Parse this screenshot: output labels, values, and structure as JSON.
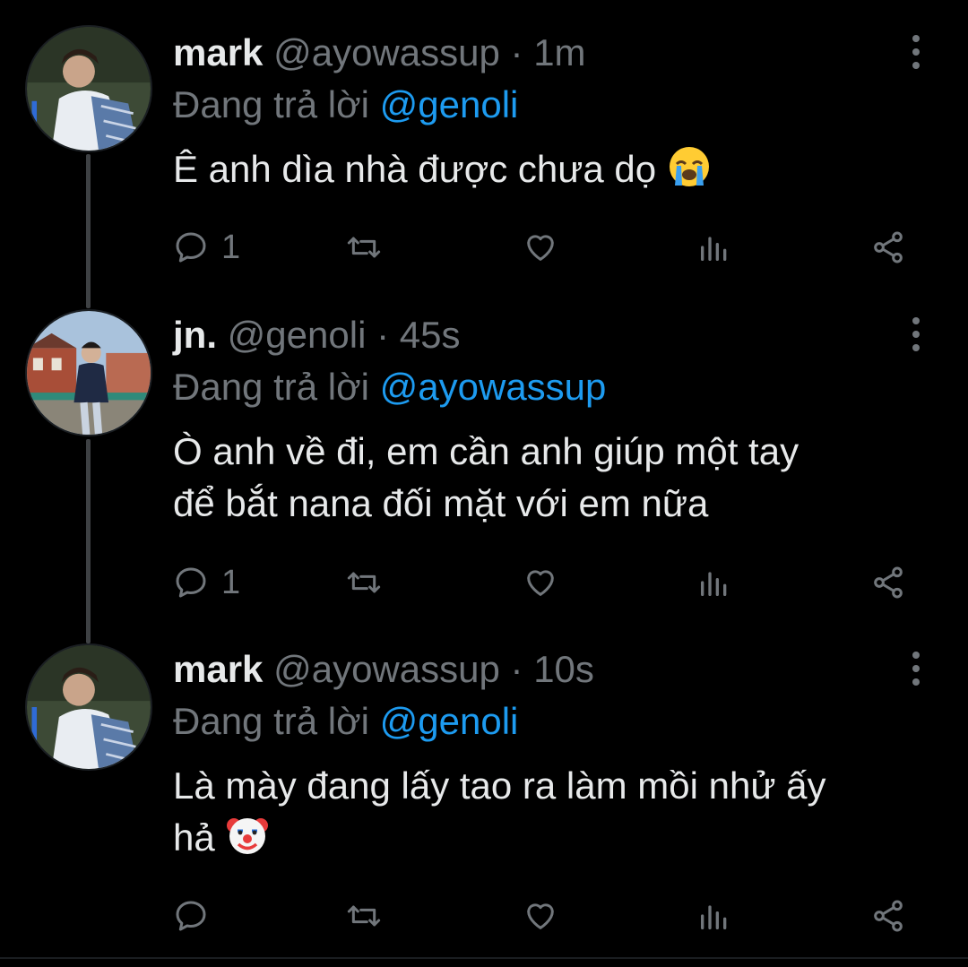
{
  "tweets": [
    {
      "name": "mark",
      "handle": "@ayowassup",
      "dot": "·",
      "time": "1m",
      "reply_prefix": "Đang trả lời",
      "reply_to": "@genoli",
      "text": "Ê anh dìa nhà được chưa dọ",
      "emoji": "loudly-crying-face",
      "reply_count": "1"
    },
    {
      "name": "jn.",
      "handle": "@genoli",
      "dot": "·",
      "time": "45s",
      "reply_prefix": "Đang trả lời",
      "reply_to": "@ayowassup",
      "text_line1": "Ò anh về đi, em cần anh giúp một tay",
      "text_line2": "để bắt nana đối mặt với em nữa",
      "reply_count": "1"
    },
    {
      "name": "mark",
      "handle": "@ayowassup",
      "dot": "·",
      "time": "10s",
      "reply_prefix": "Đang trả lời",
      "reply_to": "@genoli",
      "text_line1": "Là mày đang lấy tao ra làm mồi nhử ấy",
      "text_line2": "hả",
      "emoji": "clown-face",
      "reply_count": ""
    }
  ],
  "icons": {
    "reply": "reply-icon",
    "retweet": "retweet-icon",
    "like": "heart-icon",
    "views": "views-icon",
    "share": "share-icon",
    "more": "more-icon"
  },
  "colors": {
    "background": "#000000",
    "text": "#e7e9ea",
    "muted": "#71767b",
    "mention": "#1d9bf0"
  }
}
